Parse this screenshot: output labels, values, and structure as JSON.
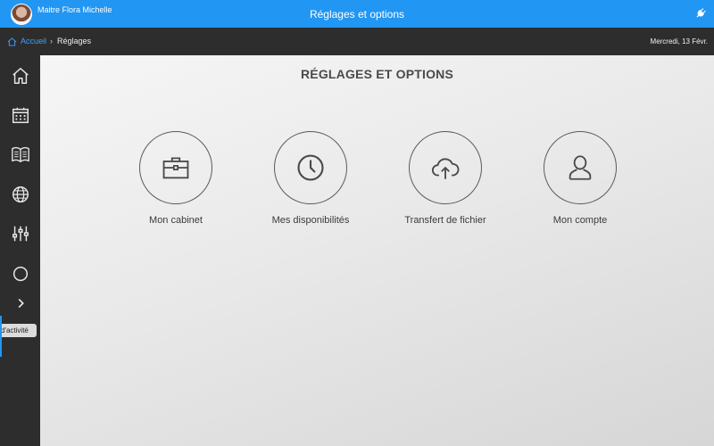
{
  "header": {
    "user_name": "Maitre Flora Michelle",
    "title": "Réglages et options",
    "plug_icon": "plug-icon",
    "accent_color": "#2196f3"
  },
  "breadcrumb": {
    "home_label": "Accueil",
    "separator": "›",
    "current": "Réglages",
    "date": "Mercredi, 13 Févr."
  },
  "sidebar": {
    "items": [
      {
        "icon": "home-icon"
      },
      {
        "icon": "calendar-icon"
      },
      {
        "icon": "book-icon"
      },
      {
        "icon": "globe-icon"
      },
      {
        "icon": "sliders-icon"
      },
      {
        "icon": "activity-icon",
        "tooltip": "d'activité"
      },
      {
        "icon": "chevron-right-icon"
      }
    ]
  },
  "main": {
    "title": "RÉGLAGES ET OPTIONS",
    "tiles": [
      {
        "label": "Mon cabinet",
        "icon": "briefcase-icon"
      },
      {
        "label": "Mes disponibilités",
        "icon": "clock-icon"
      },
      {
        "label": "Transfert de fichier",
        "icon": "cloud-upload-icon"
      },
      {
        "label": "Mon compte",
        "icon": "user-icon"
      }
    ]
  }
}
